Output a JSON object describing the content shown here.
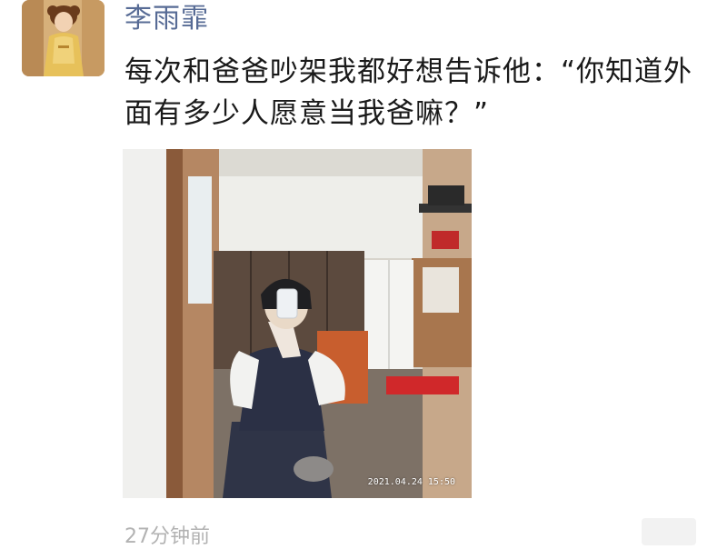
{
  "post": {
    "author": "李雨霏",
    "text": "每次和爸爸吵架我都好想告诉他：“你知道外面有多少人愿意当我爸嘛？”",
    "photo_timestamp": "2021.04.24 15:50",
    "time_ago": "27分钟前"
  },
  "colors": {
    "author_name": "#576b95",
    "body_text": "#1a1a1a",
    "time_text": "#b2b2b2"
  },
  "icons": [
    "avatar",
    "more-options-icon"
  ]
}
